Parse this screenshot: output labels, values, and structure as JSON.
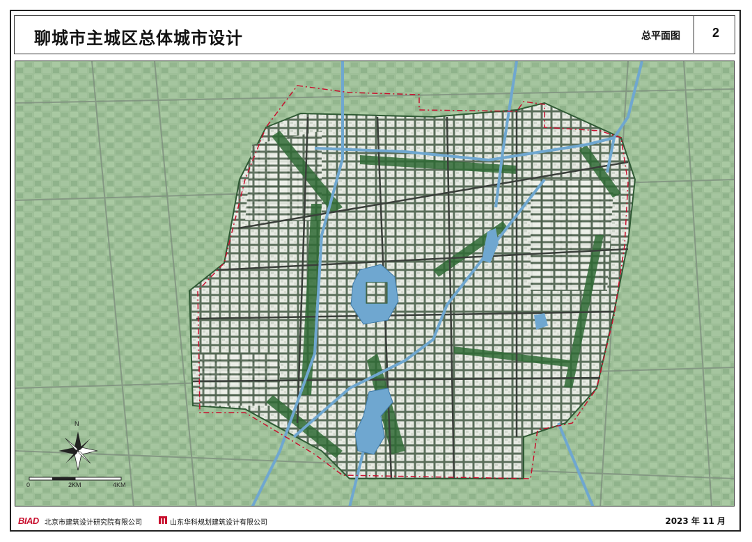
{
  "header": {
    "title": "聊城市主城区总体城市设计",
    "sheet_name": "总平面图",
    "sheet_number": "2"
  },
  "map": {
    "north_label": "N",
    "scale_labels": [
      "0",
      "2KM",
      "4KM"
    ],
    "colors": {
      "countryside": "#9fc09a",
      "urban": "#e4e8de",
      "water": "#6fa7d0",
      "green": "#2f6a35",
      "boundary": "#c8102e"
    }
  },
  "footer": {
    "logo1_text": "BIAD",
    "company1": "北京市建筑设计研究院有限公司",
    "company2": "山东华科规划建筑设计有限公司",
    "date": "2023 年 11 月"
  }
}
